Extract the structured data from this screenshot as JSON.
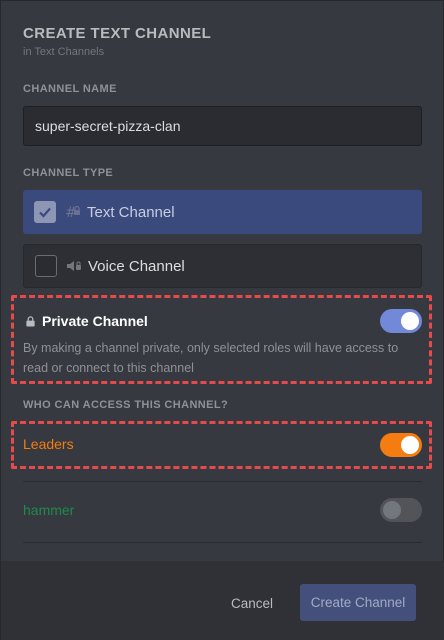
{
  "modal": {
    "title": "CREATE TEXT CHANNEL",
    "subtitle": "in Text Channels"
  },
  "channel_name": {
    "label": "CHANNEL NAME",
    "value": "super-secret-pizza-clan"
  },
  "channel_type": {
    "label": "CHANNEL TYPE",
    "options": [
      {
        "label": "Text Channel",
        "selected": true,
        "icon": "text-channel-lock-icon"
      },
      {
        "label": "Voice Channel",
        "selected": false,
        "icon": "voice-channel-lock-icon"
      }
    ]
  },
  "private_channel": {
    "title": "Private Channel",
    "description": "By making a channel private, only selected roles will have access to read or connect to this channel",
    "enabled": true,
    "icon": "lock-icon"
  },
  "access": {
    "label": "WHO CAN ACCESS THIS CHANNEL?",
    "roles": [
      {
        "name": "Leaders",
        "enabled": true,
        "color": "#f57c10"
      },
      {
        "name": "hammer",
        "enabled": false,
        "color": "#1f8b4c"
      }
    ]
  },
  "footer": {
    "cancel_label": "Cancel",
    "create_label": "Create Channel"
  },
  "colors": {
    "accent": "#7289da",
    "highlight_border": "#e54b4b"
  }
}
